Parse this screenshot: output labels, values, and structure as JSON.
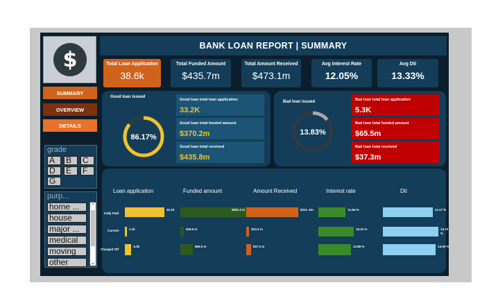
{
  "header": {
    "title": "BANK LOAN REPORT |  SUMMARY",
    "logo_icon": "dollar-coin-icon"
  },
  "kpis": [
    {
      "label": "Total Loan Application",
      "value": "38.6k",
      "active": true
    },
    {
      "label": "Total Funded Amount",
      "value": "$435.7m",
      "active": false
    },
    {
      "label": "Total Amount Received",
      "value": "$473.1m",
      "active": false
    },
    {
      "label": "Avg Interest Rate",
      "value": "12.05%",
      "active": false
    },
    {
      "label": "Avg Dti",
      "value": "13.33%",
      "active": false
    }
  ],
  "nav": {
    "summary": "SUMMARY",
    "overview": "OVERVIEW",
    "details": "DETAILS"
  },
  "slicers": {
    "grade": {
      "title": "grade",
      "items": [
        "A",
        "B",
        "C",
        "D",
        "E",
        "F",
        "G"
      ]
    },
    "purpose": {
      "title": "purp...",
      "items": [
        "home ...",
        "house",
        "major ...",
        "medical",
        "moving",
        "other"
      ]
    }
  },
  "good_loan": {
    "title": "Good loan issued",
    "percent": "86.17%",
    "percent_value": 86.17,
    "cards": [
      {
        "label": "Good loan total loan application",
        "value": "33.2K"
      },
      {
        "label": "Good loan total funded amount",
        "value": "$370.2m"
      },
      {
        "label": "Good loan total received",
        "value": "$435.8m"
      }
    ]
  },
  "bad_loan": {
    "title": "Bad loan issued",
    "percent": "13.83%",
    "percent_value": 13.83,
    "cards": [
      {
        "label": "Bad loan total loan application",
        "value": "5.3K"
      },
      {
        "label": "Bad loan total funded amount",
        "value": "$65.5m"
      },
      {
        "label": "Bad loan total received",
        "value": "$37.3m"
      }
    ]
  },
  "status_table": {
    "columns": [
      "Loan application",
      "Funded amount",
      "Amount Received",
      "Interest rate",
      "Dti"
    ],
    "rows": [
      "Fully Paid",
      "Current",
      "Charged Off"
    ],
    "loan_application": {
      "values": [
        32.1,
        1.1,
        5.3
      ],
      "labels": [
        "32.1k",
        "1.1k",
        "5.3k"
      ],
      "color": "#f2c12e"
    },
    "funded_amount": {
      "values": [
        351.3,
        18.9,
        65.5
      ],
      "labels": [
        "$351.3 m",
        "$18.9 m",
        "$65.5 m"
      ],
      "color": "#2c5a1e"
    },
    "amount_received": {
      "values": [
        411.6,
        24.2,
        37.3
      ],
      "labels": [
        "$411. 6m",
        "$24.2 m",
        "$37.3 m"
      ],
      "color": "#d0631c"
    },
    "interest_rate": {
      "values": [
        11.64,
        15.1,
        13.88
      ],
      "labels": [
        "11.64 %",
        "15.10 %",
        "13.88 %"
      ],
      "color": "#3a8a2a"
    },
    "dti": {
      "values": [
        13.17,
        14.72,
        14.0
      ],
      "labels": [
        "13.17 %",
        "14.72 %",
        "14.00 %"
      ],
      "color": "#8fd0f0"
    }
  },
  "colors": {
    "accent_orange": "#d0631c",
    "panel_blue": "#133d59",
    "gold": "#f2c12e",
    "bad_red": "#c00000"
  }
}
